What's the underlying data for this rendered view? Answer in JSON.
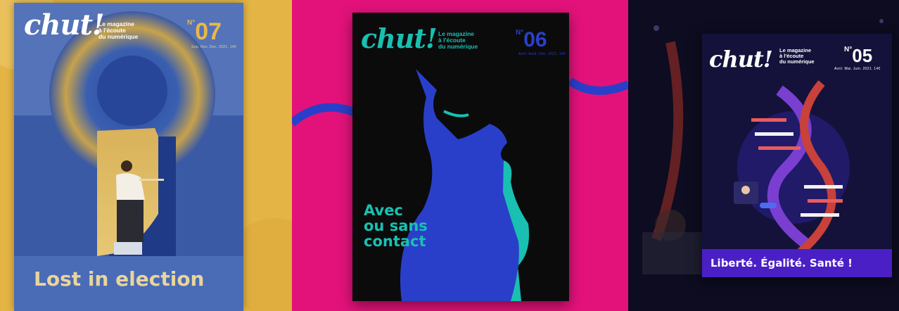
{
  "covers": [
    {
      "logo": "chut!",
      "tagline": [
        "Le magazine",
        "à l'écoute",
        "du numérique"
      ],
      "issue_prefix": "N°",
      "issue_number": "07",
      "dates": "Sep. Nov. Dec. 2021. 14€",
      "headline": [
        "Lost in election"
      ]
    },
    {
      "logo": "chut!",
      "tagline": [
        "Le magazine",
        "à l'écoute",
        "du numérique"
      ],
      "issue_prefix": "N°",
      "issue_number": "06",
      "dates": "Avril. Août. Déc. 2021. 14€",
      "headline": [
        "Avec",
        "ou sans",
        "contact"
      ]
    },
    {
      "logo": "chut!",
      "tagline": [
        "Le magazine",
        "à l'écoute",
        "du numérique"
      ],
      "issue_prefix": "N°",
      "issue_number": "05",
      "dates": "Avril. Mai. Juin. 2021. 14€",
      "headline": [
        "Liberté. Égalité. Santé !"
      ]
    }
  ],
  "colors": {
    "panel1_bg": "#e4b545",
    "cover1_blue": "#3b5aa5",
    "cover1_text": "#e9d59b",
    "panel2_bg": "#e3127a",
    "cover2_bg": "#0b0b0c",
    "cover2_accent": "#19c0b1",
    "face_blue": "#2a3fc9",
    "panel3_bg": "#0d0c20",
    "cover3_bg": "#14123a",
    "cover3_band": "#4a1fc6"
  }
}
